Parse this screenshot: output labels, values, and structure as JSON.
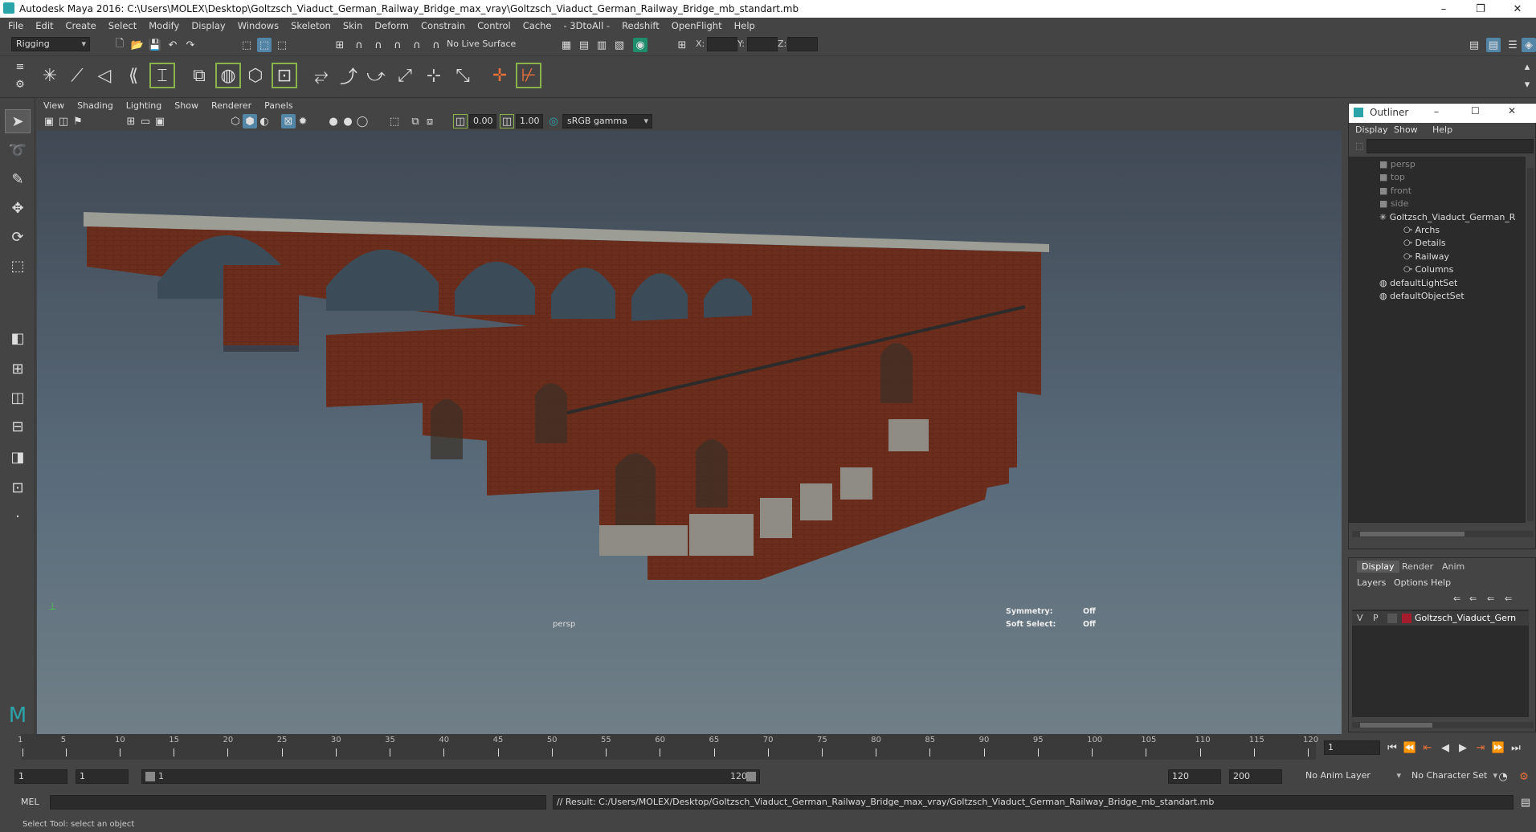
{
  "window": {
    "title": "Autodesk Maya 2016: C:\\Users\\MOLEX\\Desktop\\Goltzsch_Viaduct_German_Railway_Bridge_max_vray\\Goltzsch_Viaduct_German_Railway_Bridge_mb_standart.mb",
    "minimize": "–",
    "restore": "❐",
    "close": "✕"
  },
  "menu": [
    "File",
    "Edit",
    "Create",
    "Select",
    "Modify",
    "Display",
    "Windows",
    "Skeleton",
    "Skin",
    "Deform",
    "Constrain",
    "Control",
    "Cache",
    "- 3DtoAll -",
    "Redshift",
    "OpenFlight",
    "Help"
  ],
  "status": {
    "menu_set": "Rigging",
    "live_surface": "No Live Surface",
    "x_label": "X:",
    "y_label": "Y:",
    "z_label": "Z:"
  },
  "viewport": {
    "menus": [
      "View",
      "Shading",
      "Lighting",
      "Show",
      "Renderer",
      "Panels"
    ],
    "exposure": "0.00",
    "gamma": "1.00",
    "color_space": "sRGB gamma",
    "camera": "persp",
    "symmetry_label": "Symmetry:",
    "symmetry_value": "Off",
    "soft_select_label": "Soft Select:",
    "soft_select_value": "Off"
  },
  "outliner": {
    "title": "Outliner",
    "menus": [
      "Display",
      "Show",
      "Help"
    ],
    "items": [
      {
        "label": "persp",
        "dim": true,
        "indent": 0,
        "icon": "camera-icon"
      },
      {
        "label": "top",
        "dim": true,
        "indent": 0,
        "icon": "camera-icon"
      },
      {
        "label": "front",
        "dim": true,
        "indent": 0,
        "icon": "camera-icon"
      },
      {
        "label": "side",
        "dim": true,
        "indent": 0,
        "icon": "camera-icon"
      },
      {
        "label": "Goltzsch_Viaduct_German_R",
        "dim": false,
        "indent": 0,
        "icon": "joint-icon"
      },
      {
        "label": "Archs",
        "dim": false,
        "indent": 1,
        "icon": "group-icon"
      },
      {
        "label": "Details",
        "dim": false,
        "indent": 1,
        "icon": "group-icon"
      },
      {
        "label": "Railway",
        "dim": false,
        "indent": 1,
        "icon": "group-icon"
      },
      {
        "label": "Columns",
        "dim": false,
        "indent": 1,
        "icon": "group-icon"
      },
      {
        "label": "defaultLightSet",
        "dim": false,
        "indent": 0,
        "icon": "set-icon"
      },
      {
        "label": "defaultObjectSet",
        "dim": false,
        "indent": 0,
        "icon": "set-icon"
      }
    ]
  },
  "layers": {
    "tabs": [
      "Display",
      "Render",
      "Anim"
    ],
    "menus": [
      "Layers",
      "Options",
      "Help"
    ],
    "row": {
      "v": "V",
      "p": "P",
      "name": "Goltzsch_Viaduct_Gern",
      "color": "#a51d2d"
    }
  },
  "timeline": {
    "ticks": [
      "1",
      "5",
      "10",
      "15",
      "20",
      "25",
      "30",
      "35",
      "40",
      "45",
      "50",
      "55",
      "60",
      "65",
      "70",
      "75",
      "80",
      "85",
      "90",
      "95",
      "100",
      "105",
      "110",
      "115",
      "120"
    ],
    "current_frame": "1"
  },
  "range": {
    "start": "1",
    "playback_start": "1",
    "slider_start": "1",
    "slider_end": "120",
    "playback_end": "120",
    "end": "200",
    "anim_layer": "No Anim Layer",
    "char_set": "No Character Set"
  },
  "command": {
    "lang": "MEL",
    "result": "// Result: C:/Users/MOLEX/Desktop/Goltzsch_Viaduct_German_Railway_Bridge_max_vray/Goltzsch_Viaduct_German_Railway_Bridge_mb_standart.mb"
  },
  "help": "Select Tool: select an object"
}
